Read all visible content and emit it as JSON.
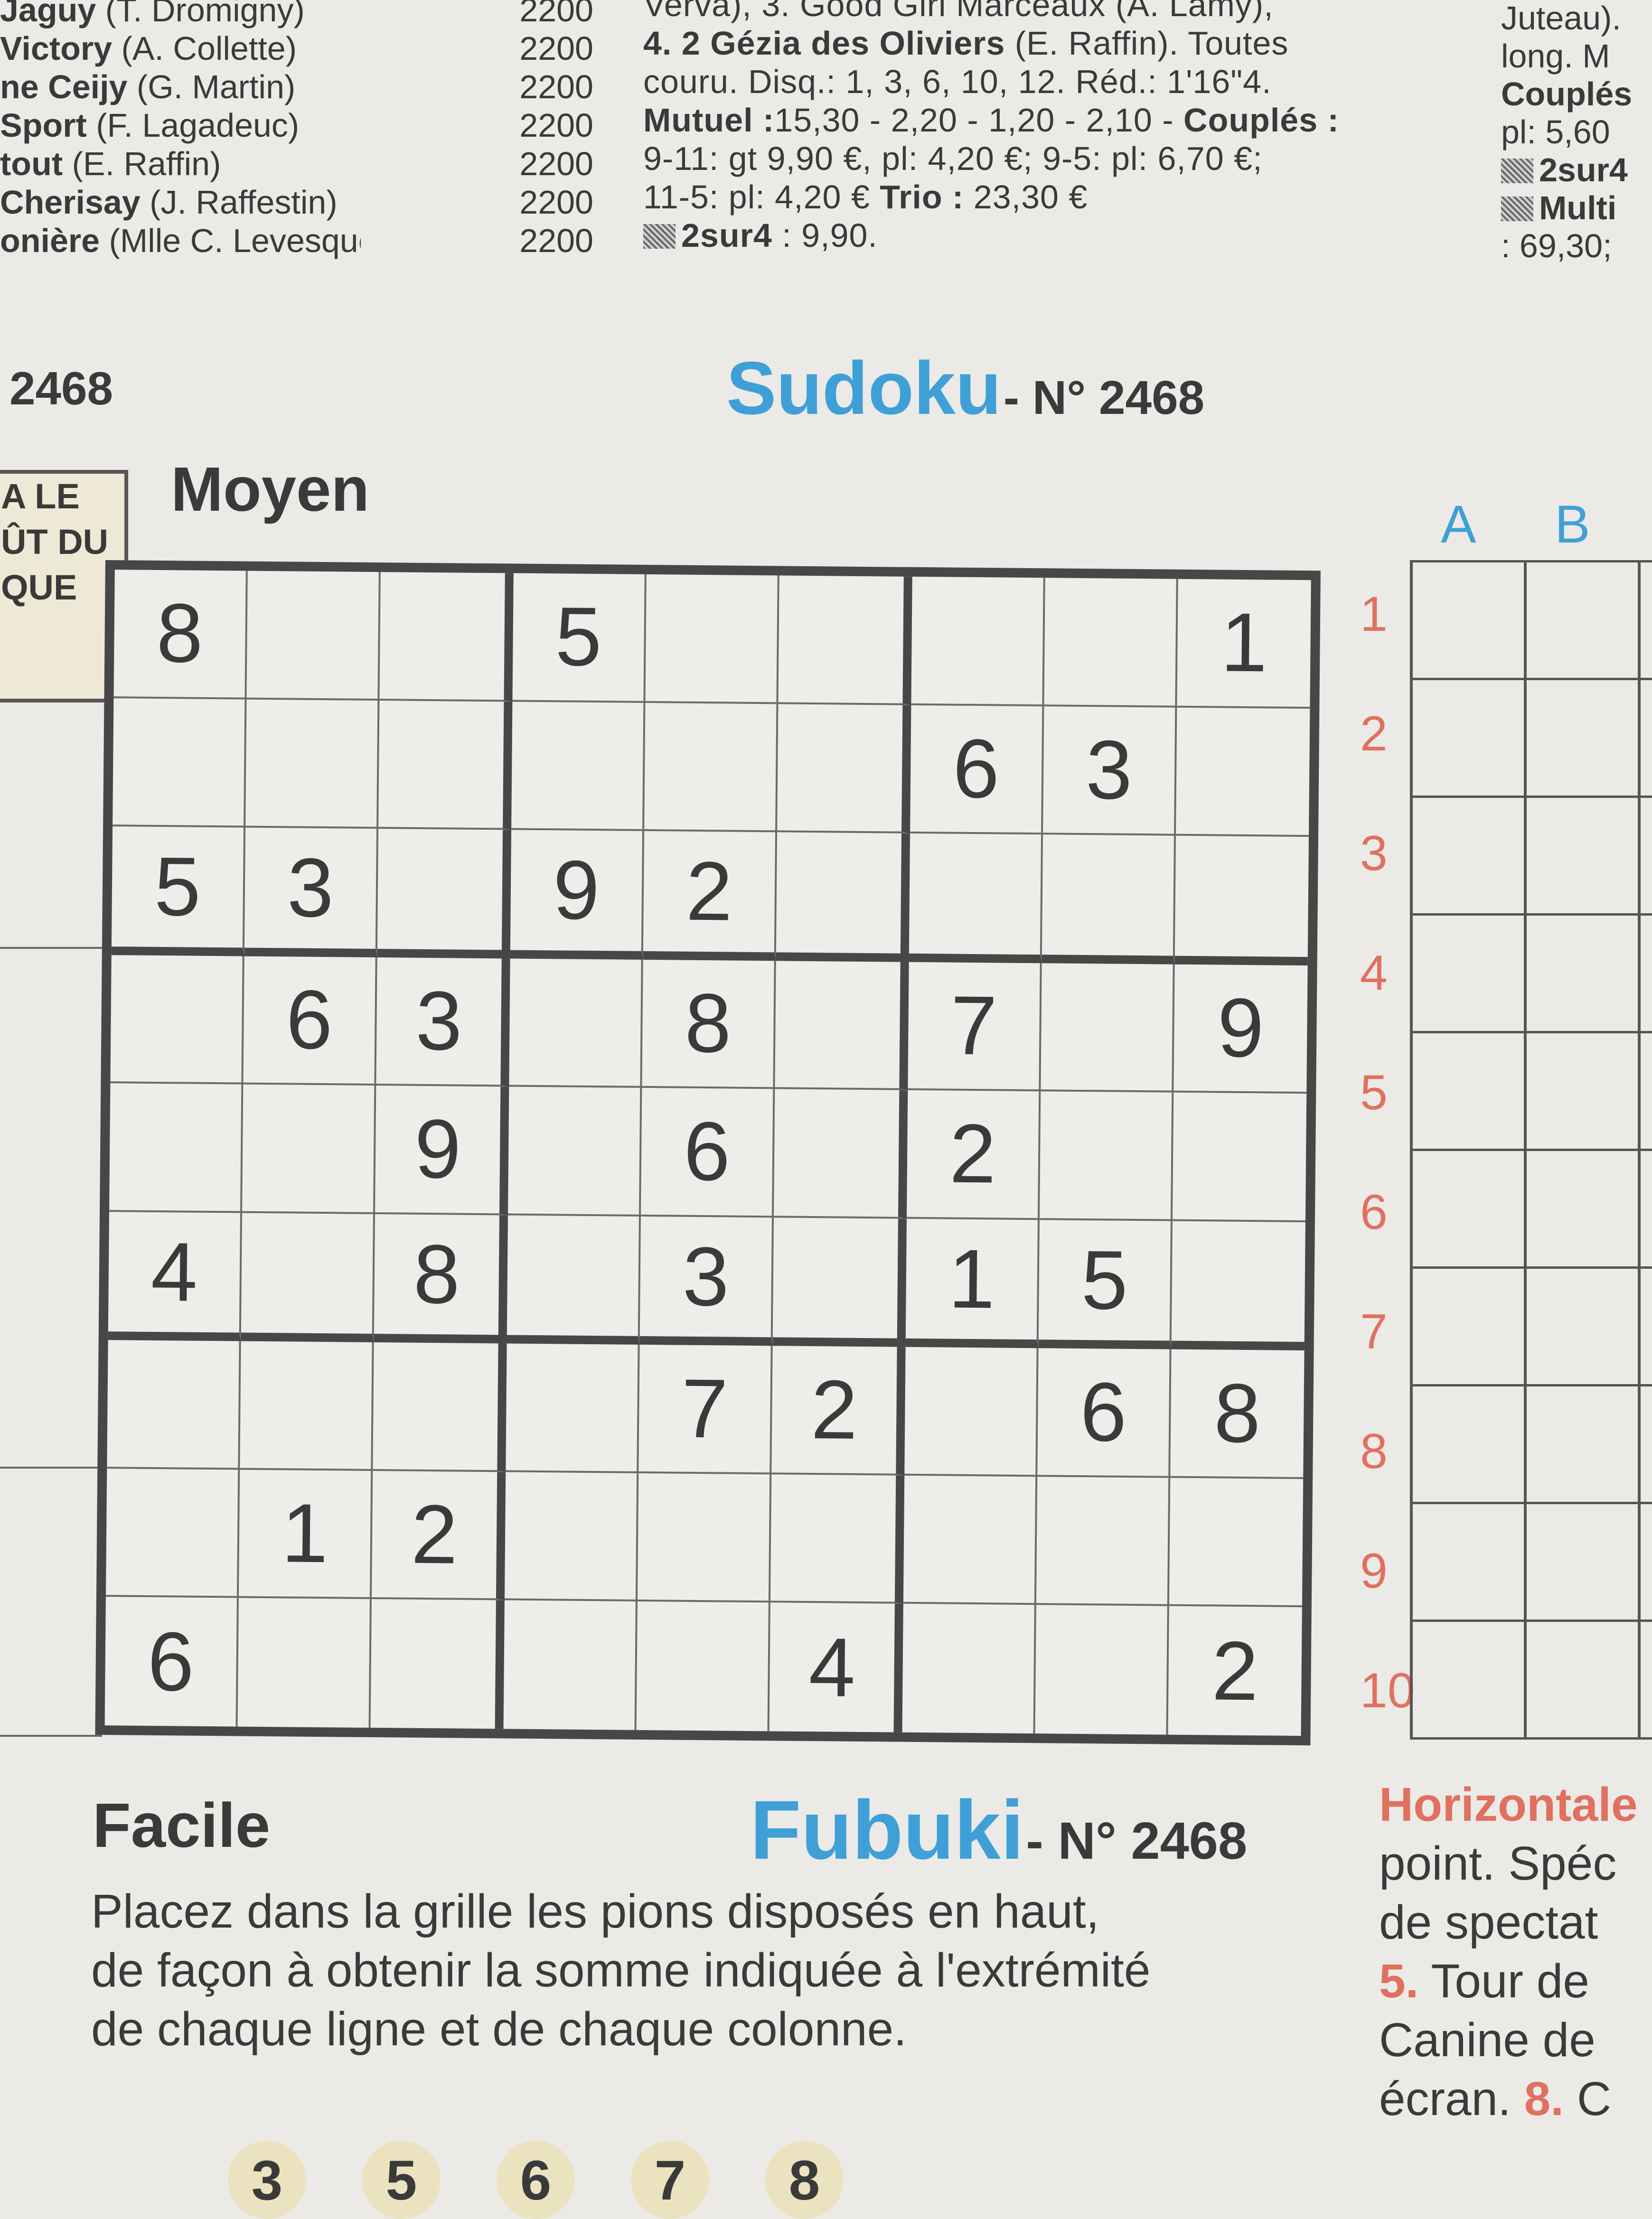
{
  "results_left": [
    {
      "name": "Jaguy",
      "driver": " (T. Dromigny)",
      "dist": "2200"
    },
    {
      "name": "Victory",
      "driver": " (A. Collette)",
      "dist": "2200"
    },
    {
      "name": "ne Ceijy",
      "driver": " (G. Martin)",
      "dist": "2200"
    },
    {
      "name": "Sport",
      "driver": " (F. Lagadeuc)",
      "dist": "2200"
    },
    {
      "name": "tout",
      "driver": " (E. Raffin)",
      "dist": "2200"
    },
    {
      "name": "Cherisay",
      "driver": " (J. Raffestin)",
      "dist": "2200"
    },
    {
      "name": "onière",
      "driver": " (Mlle C. Levesque)",
      "dist": "2200"
    }
  ],
  "results_center": {
    "line0": "Verva), 3. Good Girl Marceaux (A. Lamy),",
    "line1_bold": "4. 2 Gézia des Oliviers",
    "line1_rest": " (E. Raffin). Toutes",
    "line2": "couru. Disq.: 1, 3, 6, 10, 12. Réd.: 1'16\"4.",
    "line3_bold": "Mutuel :",
    "line3_rest": "15,30 - 2,20 - 1,20 - 2,10 - ",
    "line3_bold2": "Couplés :",
    "line4": "9-11: gt 9,90 €, pl: 4,20 €; 9-5: pl: 6,70 €;",
    "line5_a": "11-5: pl: 4,20 € ",
    "line5_bold": "Trio :",
    "line5_b": " 23,30 €",
    "line6_bold": "2sur4",
    "line6_rest": " : 9,90."
  },
  "results_right": [
    "Juteau).",
    "long. M",
    "Couplés",
    "pl: 5,60",
    "2sur4",
    "Multi",
    ": 69,30;"
  ],
  "puzzle_code": "2468",
  "sudoku": {
    "title": "Sudoku",
    "number_label": "- N° 2468",
    "level": "Moyen",
    "grid": [
      [
        "8",
        "",
        "",
        "5",
        "",
        "",
        "",
        "",
        "1"
      ],
      [
        "",
        "",
        "",
        "",
        "",
        "",
        "6",
        "3",
        ""
      ],
      [
        "5",
        "3",
        "",
        "9",
        "2",
        "",
        "",
        "",
        ""
      ],
      [
        "",
        "6",
        "3",
        "",
        "8",
        "",
        "7",
        "",
        "9"
      ],
      [
        "",
        "",
        "9",
        "",
        "6",
        "",
        "2",
        "",
        ""
      ],
      [
        "4",
        "",
        "8",
        "",
        "3",
        "",
        "1",
        "5",
        ""
      ],
      [
        "",
        "",
        "",
        "",
        "7",
        "2",
        "",
        "6",
        "8"
      ],
      [
        "",
        "1",
        "2",
        "",
        "",
        "",
        "",
        "",
        ""
      ],
      [
        "6",
        "",
        "",
        "",
        "",
        "4",
        "",
        "",
        "2"
      ]
    ]
  },
  "side_box": [
    "A LE",
    "ÛT DU",
    "QUE"
  ],
  "crossword": {
    "columns": [
      "A",
      "B"
    ],
    "rows": [
      "1",
      "2",
      "3",
      "4",
      "5",
      "6",
      "7",
      "8",
      "9",
      "10"
    ]
  },
  "fubuki": {
    "level": "Facile",
    "title": "Fubuki",
    "number_label": "- N° 2468",
    "instructions": [
      "Placez dans la grille les pions disposés en haut,",
      "de façon à obtenir la somme indiquée à l'extrémité",
      "de chaque ligne et de chaque colonne."
    ],
    "pions": [
      "3",
      "5",
      "6",
      "7",
      "8"
    ]
  },
  "definitions": {
    "header": "Horizontale",
    "lines": [
      "point. Spéc",
      "de spectat"
    ],
    "item5_num": "5.",
    "item5_text": " Tour de",
    "line_canine": "Canine de",
    "line_ecran": "écran. ",
    "item8_num": "8.",
    "item8_text": " C"
  },
  "colors": {
    "accent_blue": "#3ea0d6",
    "accent_red": "#e07060",
    "ink": "#3a3a3a",
    "paper": "#eceae6"
  }
}
